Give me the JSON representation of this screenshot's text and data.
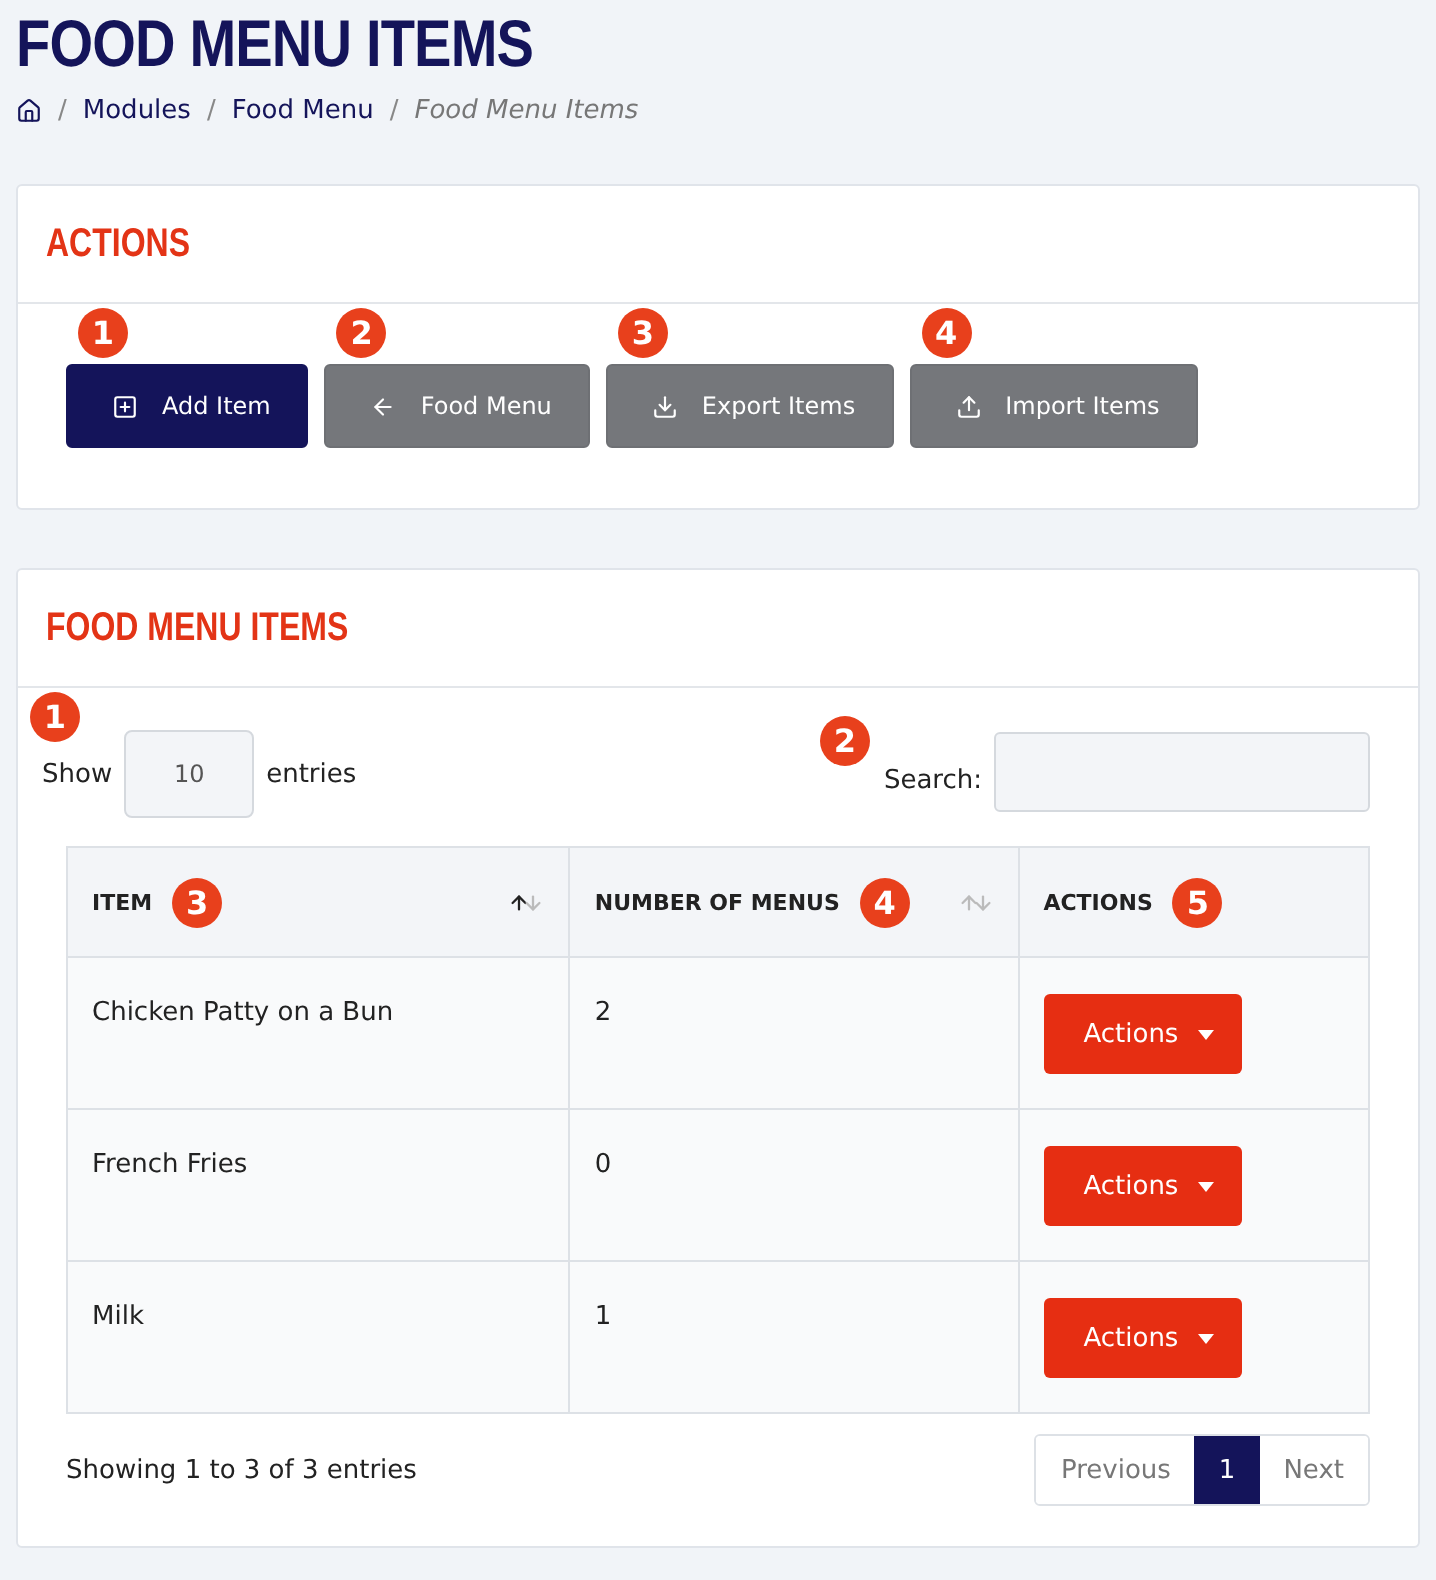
{
  "page_title": "FOOD MENU ITEMS",
  "breadcrumb": [
    {
      "separator": "/",
      "label": "Modules",
      "current": false
    },
    {
      "separator": "/",
      "label": "Food Menu",
      "current": false
    },
    {
      "separator": "/",
      "label": "Food Menu Items",
      "current": true
    }
  ],
  "actions_card": {
    "title": "ACTIONS",
    "buttons": [
      {
        "badge": "1",
        "label": "Add Item",
        "kind": "primary"
      },
      {
        "badge": "2",
        "label": "Food Menu",
        "kind": "secondary"
      },
      {
        "badge": "3",
        "label": "Export Items",
        "kind": "secondary"
      },
      {
        "badge": "4",
        "label": "Import Items",
        "kind": "secondary"
      }
    ]
  },
  "items_card": {
    "title": "FOOD MENU ITEMS",
    "length": {
      "badge": "1",
      "before": "Show",
      "value": "10",
      "after": "entries"
    },
    "search": {
      "badge": "2",
      "label": "Search:"
    },
    "table": {
      "columns": [
        {
          "label": "ITEM",
          "badge": "3",
          "sortable": true,
          "sorted": true
        },
        {
          "label": "NUMBER OF MENUS",
          "badge": "4",
          "sortable": true,
          "sorted": false
        },
        {
          "label": "ACTIONS",
          "badge": "5"
        }
      ],
      "rows": [
        {
          "item": "Chicken Patty on a Bun",
          "menus": "2",
          "action": "Actions"
        },
        {
          "item": "French Fries",
          "menus": "0",
          "action": "Actions"
        },
        {
          "item": "Milk",
          "menus": "1",
          "action": "Actions"
        }
      ]
    },
    "info": "Showing 1 to 3 of 3 entries",
    "pagination": [
      {
        "label": "Previous",
        "selected": false
      },
      {
        "label": "1",
        "selected": true
      },
      {
        "label": "Next",
        "selected": false
      }
    ]
  }
}
